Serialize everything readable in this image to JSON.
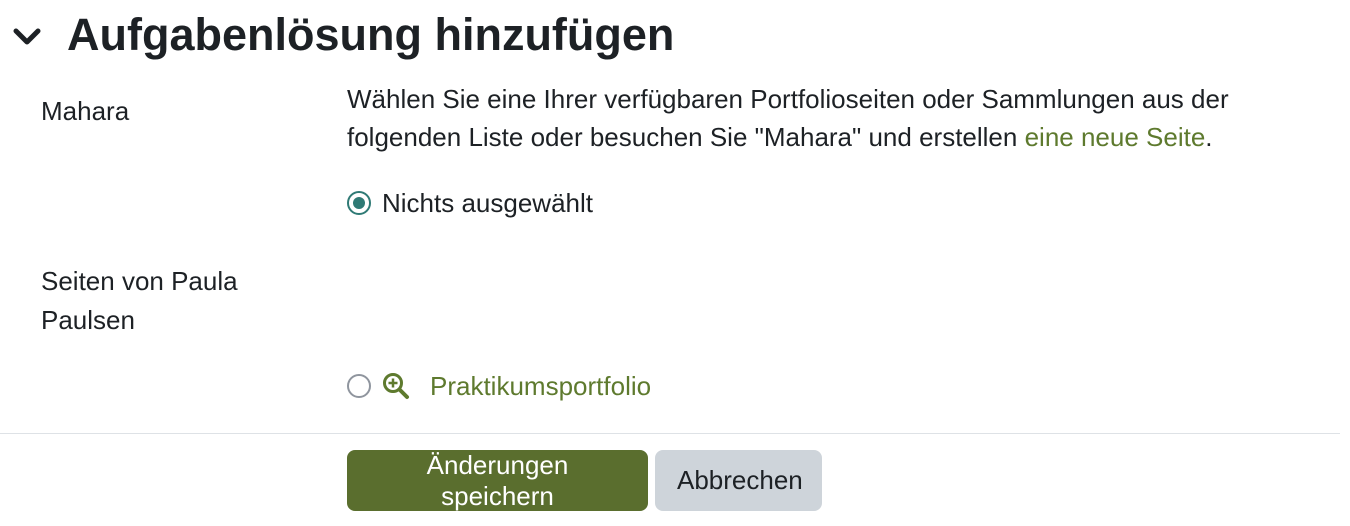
{
  "section": {
    "title": "Aufgabenlösung hinzufügen",
    "toggle_icon": "chevron-down-icon"
  },
  "mahara": {
    "label": "Mahara",
    "description_before": "Wählen Sie eine Ihrer verfügbaren Portfolioseiten oder Sammlungen aus der folgenden Liste oder besuchen Sie \"Mahara\" und erstellen ",
    "description_link": "eine neue Seite",
    "description_after": "."
  },
  "options": {
    "none_label": "Nichts ausgewählt",
    "none_selected": true
  },
  "pages": {
    "label": "Seiten von Paula Paulsen",
    "items": [
      {
        "label": "Praktikumsportfolio",
        "selected": false,
        "icon": "zoom-in-icon"
      }
    ]
  },
  "buttons": {
    "save_label": "Änderungen speichern",
    "cancel_label": "Abbrechen"
  },
  "colors": {
    "primary": "#5a6e2e",
    "link": "#5e7a2e",
    "radio_checked": "#2f7a75",
    "secondary": "#ced4da"
  }
}
